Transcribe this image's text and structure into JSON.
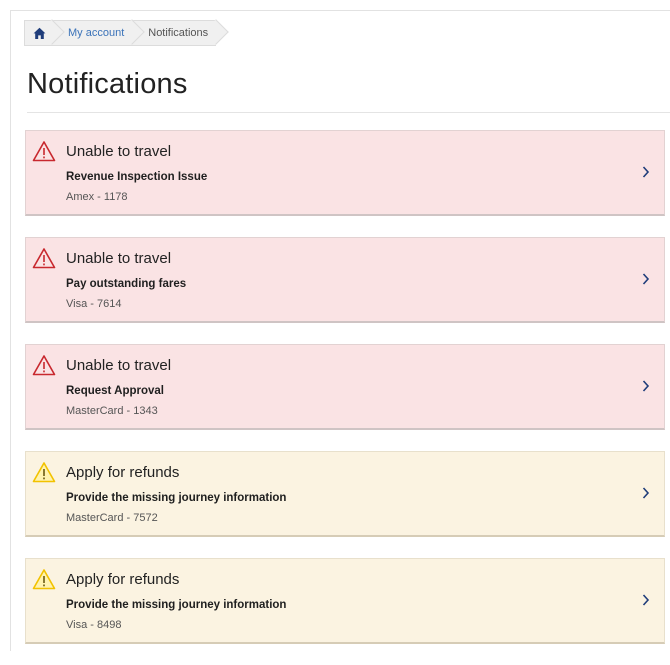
{
  "breadcrumb": {
    "home_icon": "home-icon",
    "items": [
      {
        "label": "My account"
      },
      {
        "label": "Notifications"
      }
    ]
  },
  "page": {
    "title": "Notifications"
  },
  "colors": {
    "error_bg": "#fae3e4",
    "warning_bg": "#fbf3e1",
    "error_icon": "#c8282e",
    "warning_icon": "#f2c200",
    "link": "#3b73b9"
  },
  "notifications": [
    {
      "type": "error",
      "icon": "warning-triangle-icon",
      "title": "Unable to travel",
      "subtitle": "Revenue Inspection Issue",
      "detail": "Amex - 1178"
    },
    {
      "type": "error",
      "icon": "warning-triangle-icon",
      "title": "Unable to travel",
      "subtitle": "Pay outstanding fares",
      "detail": "Visa - 7614"
    },
    {
      "type": "error",
      "icon": "warning-triangle-icon",
      "title": "Unable to travel",
      "subtitle": "Request Approval",
      "detail": "MasterCard - 1343"
    },
    {
      "type": "warning",
      "icon": "warning-triangle-icon",
      "title": "Apply for refunds",
      "subtitle": "Provide the missing journey information",
      "detail": "MasterCard - 7572"
    },
    {
      "type": "warning",
      "icon": "warning-triangle-icon",
      "title": "Apply for refunds",
      "subtitle": "Provide the missing journey information",
      "detail": "Visa - 8498"
    }
  ]
}
